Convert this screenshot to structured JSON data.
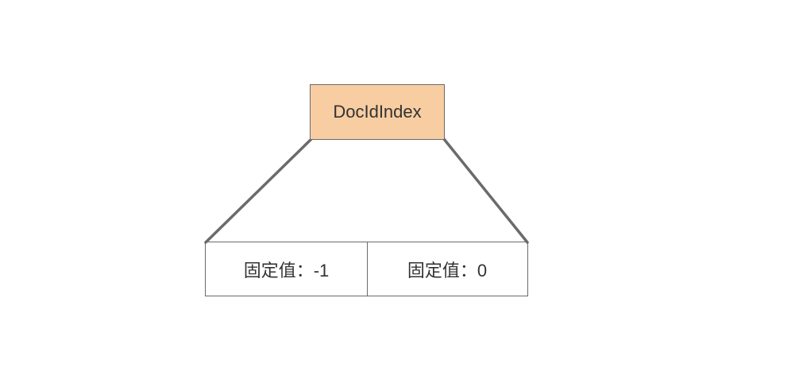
{
  "colors": {
    "root_fill": "#f8cda2",
    "stroke": "#6b6b6b",
    "text": "#333333",
    "background": "#ffffff"
  },
  "root": {
    "label": "DocIdIndex"
  },
  "children": [
    {
      "label": "固定值：-1"
    },
    {
      "label": "固定值：0"
    }
  ]
}
